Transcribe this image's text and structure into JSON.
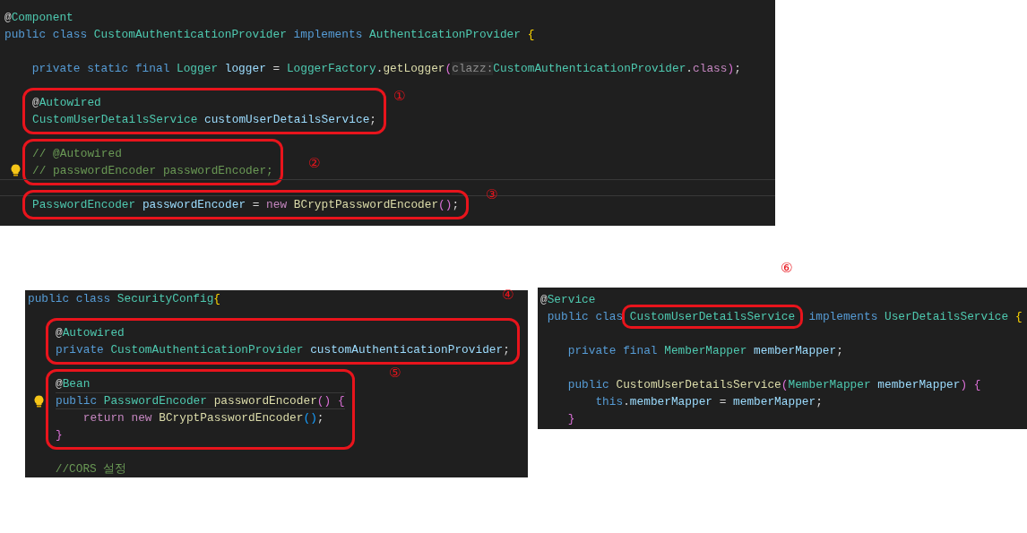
{
  "panels": [
    {
      "items": [
        {
          "kind": "line",
          "current": false,
          "tokens": [
            {
              "kind": "plain",
              "text": "@"
            },
            {
              "kind": "type",
              "text": "Component"
            }
          ]
        },
        {
          "kind": "line",
          "current": false,
          "tokens": [
            {
              "kind": "keyword",
              "text": "public class "
            },
            {
              "kind": "type",
              "text": "CustomAuthenticationProvider "
            },
            {
              "kind": "keyword",
              "text": "implements "
            },
            {
              "kind": "type",
              "text": "AuthenticationProvider "
            },
            {
              "kind": "bracket1",
              "text": "{"
            }
          ]
        },
        {
          "kind": "blank",
          "current": false
        },
        {
          "kind": "line",
          "current": false,
          "tokens": [
            {
              "kind": "keyword",
              "text": "    private static final "
            },
            {
              "kind": "type",
              "text": "Logger "
            },
            {
              "kind": "variable",
              "text": "logger "
            },
            {
              "kind": "plain",
              "text": "= "
            },
            {
              "kind": "type",
              "text": "LoggerFactory"
            },
            {
              "kind": "plain",
              "text": "."
            },
            {
              "kind": "function",
              "text": "getLogger"
            },
            {
              "kind": "bracket2",
              "text": "("
            },
            {
              "kind": "hint",
              "text": "clazz:"
            },
            {
              "kind": "type",
              "text": "CustomAuthenticationProvider"
            },
            {
              "kind": "plain",
              "text": "."
            },
            {
              "kind": "control",
              "text": "class"
            },
            {
              "kind": "bracket2",
              "text": ")"
            },
            {
              "kind": "plain",
              "text": ";"
            }
          ]
        },
        {
          "kind": "blank",
          "current": false
        },
        {
          "kind": "group",
          "callout": "①",
          "lines": [
            {
              "current": false,
              "tokens": [
                {
                  "kind": "plain",
                  "text": "@"
                },
                {
                  "kind": "type",
                  "text": "Autowired"
                }
              ]
            },
            {
              "current": false,
              "tokens": [
                {
                  "kind": "type",
                  "text": "CustomUserDetailsService "
                },
                {
                  "kind": "variable",
                  "text": "customUserDetailsService"
                },
                {
                  "kind": "plain",
                  "text": ";"
                }
              ]
            }
          ]
        },
        {
          "kind": "blank",
          "current": false
        },
        {
          "kind": "group",
          "callout": "②",
          "lines": [
            {
              "current": false,
              "tokens": [
                {
                  "kind": "comment",
                  "text": "// @Autowired"
                }
              ]
            },
            {
              "current": false,
              "lightbulb": true,
              "tokens": [
                {
                  "kind": "comment",
                  "text": "// passwordEncoder passwordEncoder;"
                }
              ]
            }
          ]
        },
        {
          "kind": "blank",
          "current": true
        },
        {
          "kind": "group",
          "callout": "③",
          "lines": [
            {
              "current": false,
              "tokens": [
                {
                  "kind": "type",
                  "text": "PasswordEncoder "
                },
                {
                  "kind": "variable",
                  "text": "passwordEncoder "
                },
                {
                  "kind": "plain",
                  "text": "= "
                },
                {
                  "kind": "control",
                  "text": "new "
                },
                {
                  "kind": "function",
                  "text": "BCryptPasswordEncoder"
                },
                {
                  "kind": "bracket2",
                  "text": "()"
                },
                {
                  "kind": "plain",
                  "text": ";"
                }
              ]
            }
          ]
        }
      ]
    },
    {
      "items": [
        {
          "kind": "line",
          "current": false,
          "tokens": [
            {
              "kind": "keyword",
              "text": "public class "
            },
            {
              "kind": "type",
              "text": "SecurityConfig"
            },
            {
              "kind": "bracket1",
              "text": "{"
            }
          ]
        },
        {
          "kind": "blank",
          "current": false
        },
        {
          "kind": "group",
          "callout": "④",
          "lines": [
            {
              "current": false,
              "tokens": [
                {
                  "kind": "plain",
                  "text": "@"
                },
                {
                  "kind": "type",
                  "text": "Autowired"
                }
              ]
            },
            {
              "current": false,
              "tokens": [
                {
                  "kind": "keyword",
                  "text": "private "
                },
                {
                  "kind": "type",
                  "text": "CustomAuthenticationProvider "
                },
                {
                  "kind": "variable",
                  "text": "customAuthenticationProvider"
                },
                {
                  "kind": "plain",
                  "text": ";"
                }
              ]
            }
          ]
        },
        {
          "kind": "blank",
          "current": false
        },
        {
          "kind": "group",
          "callout": "⑤",
          "lines": [
            {
              "current": false,
              "tokens": [
                {
                  "kind": "plain",
                  "text": "@"
                },
                {
                  "kind": "type",
                  "text": "Bean"
                }
              ]
            },
            {
              "current": true,
              "lightbulb": true,
              "tokens": [
                {
                  "kind": "keyword",
                  "text": "public "
                },
                {
                  "kind": "type",
                  "text": "PasswordEncoder "
                },
                {
                  "kind": "function",
                  "text": "passwordEncoder"
                },
                {
                  "kind": "bracket2",
                  "text": "() {"
                }
              ]
            },
            {
              "current": false,
              "tokens": [
                {
                  "kind": "control",
                  "text": "    return new "
                },
                {
                  "kind": "function",
                  "text": "BCryptPasswordEncoder"
                },
                {
                  "kind": "bracket3",
                  "text": "()"
                },
                {
                  "kind": "plain",
                  "text": ";"
                }
              ]
            },
            {
              "current": false,
              "tokens": [
                {
                  "kind": "bracket2",
                  "text": "}"
                }
              ]
            }
          ]
        },
        {
          "kind": "blank",
          "current": false
        },
        {
          "kind": "line",
          "current": false,
          "tokens": [
            {
              "kind": "comment",
              "text": "    //CORS 설정"
            }
          ]
        }
      ]
    },
    {
      "items": [
        {
          "kind": "line",
          "current": false,
          "tokens": [
            {
              "kind": "plain",
              "text": "@"
            },
            {
              "kind": "type",
              "text": "Service"
            }
          ]
        },
        {
          "kind": "line",
          "current": false,
          "tokens": [
            {
              "kind": "keyword",
              "text": "public clas "
            },
            {
              "kind": "outlined",
              "callout": "⑥",
              "tokens": [
                {
                  "kind": "type",
                  "text": "CustomUserDetailsService"
                }
              ]
            },
            {
              "kind": "keyword",
              "text": " implements "
            },
            {
              "kind": "type",
              "text": "UserDetailsService "
            },
            {
              "kind": "bracket1",
              "text": "{"
            }
          ]
        },
        {
          "kind": "blank",
          "current": false
        },
        {
          "kind": "line",
          "current": false,
          "tokens": [
            {
              "kind": "keyword",
              "text": "    private final "
            },
            {
              "kind": "type",
              "text": "MemberMapper "
            },
            {
              "kind": "variable",
              "text": "memberMapper"
            },
            {
              "kind": "plain",
              "text": ";"
            }
          ]
        },
        {
          "kind": "blank",
          "current": false
        },
        {
          "kind": "line",
          "current": false,
          "tokens": [
            {
              "kind": "keyword",
              "text": "    public "
            },
            {
              "kind": "function",
              "text": "CustomUserDetailsService"
            },
            {
              "kind": "bracket2",
              "text": "("
            },
            {
              "kind": "type",
              "text": "MemberMapper "
            },
            {
              "kind": "variable",
              "text": "memberMapper"
            },
            {
              "kind": "bracket2",
              "text": ") {"
            }
          ]
        },
        {
          "kind": "line",
          "current": false,
          "tokens": [
            {
              "kind": "keyword",
              "text": "        this"
            },
            {
              "kind": "plain",
              "text": "."
            },
            {
              "kind": "variable",
              "text": "memberMapper "
            },
            {
              "kind": "plain",
              "text": "= "
            },
            {
              "kind": "variable",
              "text": "memberMapper"
            },
            {
              "kind": "plain",
              "text": ";"
            }
          ]
        },
        {
          "kind": "line",
          "current": false,
          "tokens": [
            {
              "kind": "bracket2",
              "text": "    }"
            }
          ]
        }
      ]
    }
  ]
}
